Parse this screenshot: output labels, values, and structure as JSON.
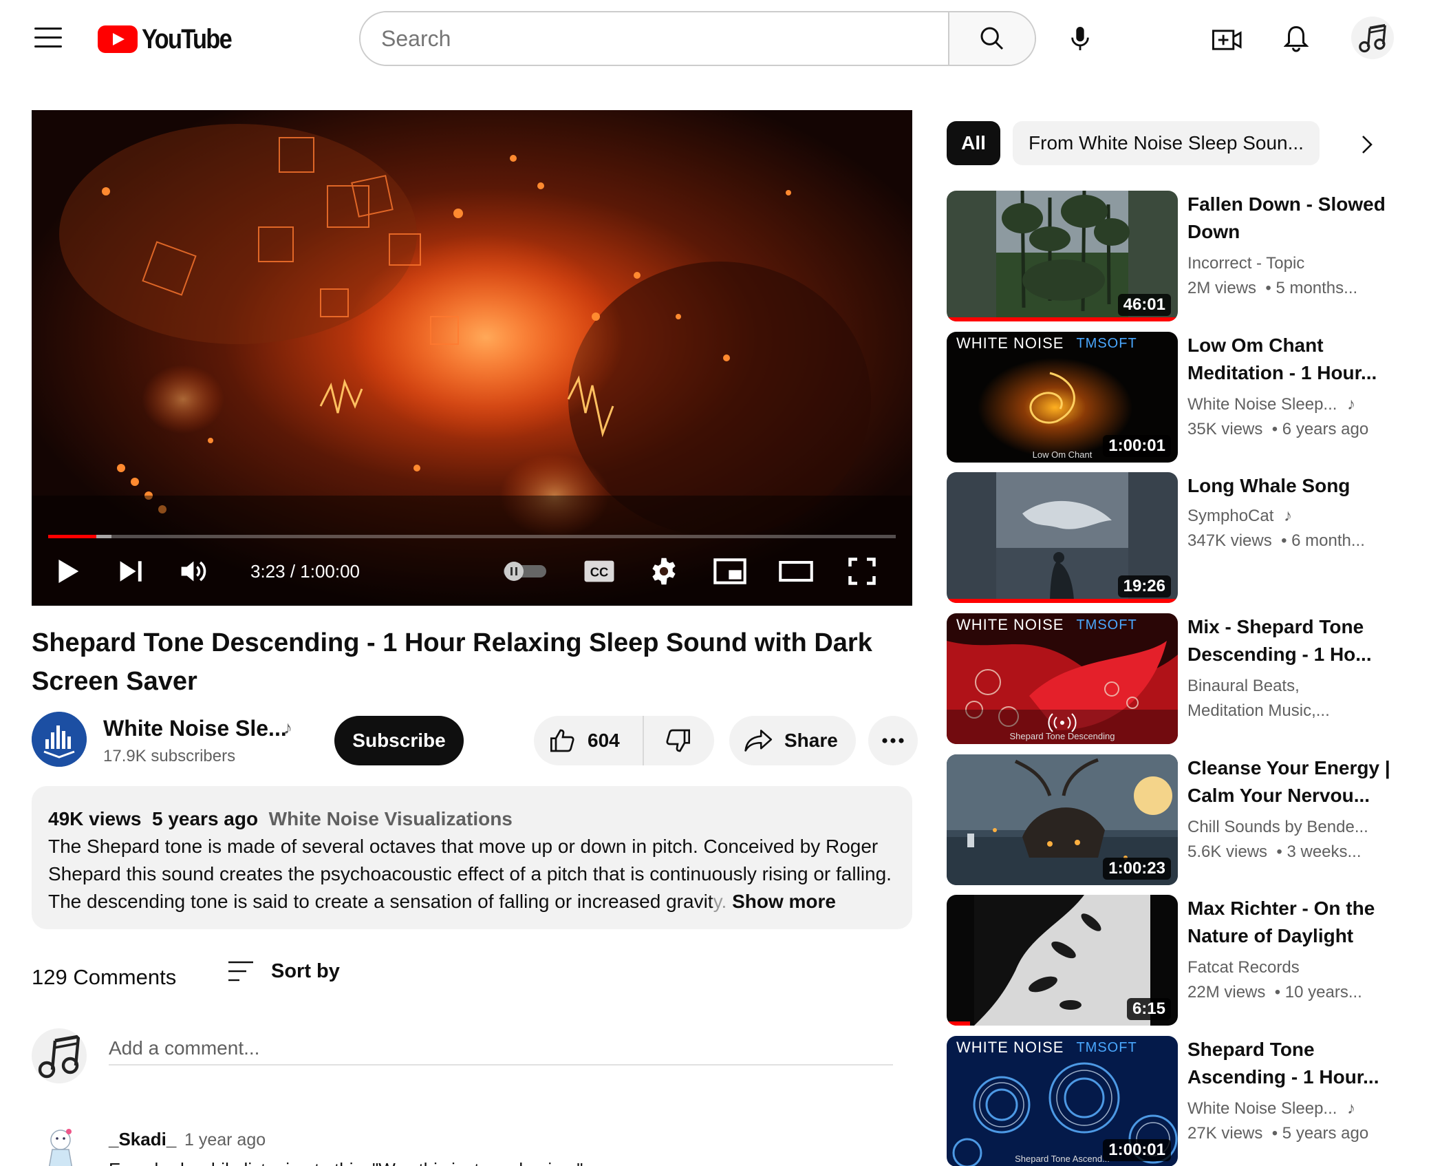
{
  "header": {
    "logo_text": "YouTube",
    "search_placeholder": "Search"
  },
  "player": {
    "time_display": "3:23 / 1:00:00",
    "progress_fraction": 0.057,
    "buffered_fraction": 0.075
  },
  "video": {
    "title": "Shepard Tone Descending - 1 Hour Relaxing Sleep Sound with Dark Screen Saver",
    "channel_name": "White Noise Sle...",
    "subscribers": "17.9K subscribers",
    "subscribe_label": "Subscribe",
    "likes": "604",
    "share_label": "Share"
  },
  "description": {
    "views": "49K views",
    "age": "5 years ago",
    "tag": "White Noise Visualizations",
    "text": "The Shepard tone is made of several octaves that move up or down in pitch. Conceived by Roger Shepard this sound creates the psychoacoustic effect of a pitch that is continuously rising or falling. The descending tone is said to create a sensation of falling or increased gravit",
    "text_fade": "y.",
    "show_more": "Show more"
  },
  "comments": {
    "count_label": "129 Comments",
    "sort_label": "Sort by",
    "add_placeholder": "Add a comment...",
    "first": {
      "author": "_Skadi_",
      "time": "1 year ago",
      "text": "Everybody while listening to this: \"Was this just a ... basin...\""
    }
  },
  "sidebar": {
    "chips": [
      "All",
      "From White Noise Sleep Soun..."
    ],
    "recommendations": [
      {
        "title": "Fallen Down - Slowed Down",
        "channel": "Incorrect - Topic",
        "views": "2M views",
        "age": "5 months...",
        "duration": "46:01",
        "watched_fraction": 1.0,
        "verified_music": false
      },
      {
        "title": "Low Om Chant Meditation - 1 Hour...",
        "channel": "White Noise Sleep...",
        "views": "35K views",
        "age": "6 years ago",
        "duration": "1:00:01",
        "watched_fraction": 0,
        "verified_music": true,
        "banner": "WHITE NOISE",
        "banner_sub": "TMSOFT",
        "caption": "Low Om Chant"
      },
      {
        "title": "Long Whale Song",
        "channel": "SymphoCat",
        "views": "347K views",
        "age": "6 month...",
        "duration": "19:26",
        "watched_fraction": 1.0,
        "verified_music": true
      },
      {
        "title": "Mix - Shepard Tone Descending - 1 Ho...",
        "channel": "Binaural Beats,",
        "channel2": "Meditation Music,...",
        "duration": "",
        "watched_fraction": 0,
        "banner": "WHITE NOISE",
        "banner_sub": "TMSOFT",
        "caption": "Shepard Tone Descending"
      },
      {
        "title": "Cleanse Your Energy | Calm Your Nervou...",
        "channel": "Chill Sounds by Bende...",
        "views": "5.6K views",
        "age": "3 weeks...",
        "duration": "1:00:23",
        "watched_fraction": 0,
        "verified_music": false
      },
      {
        "title": "Max Richter - On the Nature of Daylight",
        "channel": "Fatcat Records",
        "views": "22M views",
        "age": "10 years...",
        "duration": "6:15",
        "watched_fraction": 0.1,
        "verified_music": false
      },
      {
        "title": "Shepard Tone Ascending - 1 Hour...",
        "channel": "White Noise Sleep...",
        "views": "27K views",
        "age": "5 years ago",
        "duration": "1:00:01",
        "watched_fraction": 0,
        "verified_music": true,
        "banner": "WHITE NOISE",
        "banner_sub": "TMSOFT",
        "caption": "Shepard Tone Ascend..."
      }
    ]
  },
  "colors": {
    "brand_red": "#ff0000",
    "text_primary": "#0f0f0f",
    "text_secondary": "#606060",
    "chip_bg": "#f2f2f2"
  }
}
